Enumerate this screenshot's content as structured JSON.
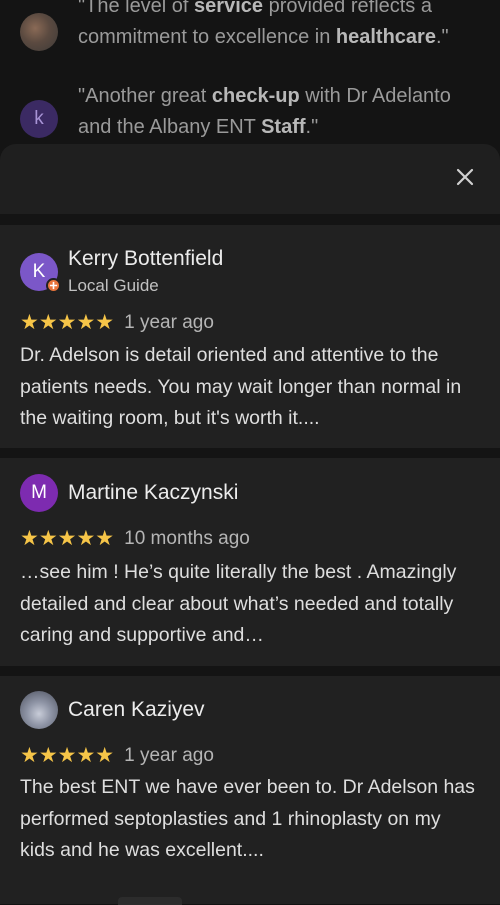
{
  "background_snippets": [
    {
      "avatar_letter": "",
      "parts": [
        {
          "text": "\"The level of ",
          "bold": false
        },
        {
          "text": "service",
          "bold": true
        },
        {
          "text": " provided reflects a commitment to excellence in ",
          "bold": false
        },
        {
          "text": "healthcare",
          "bold": true
        },
        {
          "text": ".\"",
          "bold": false
        }
      ]
    },
    {
      "avatar_letter": "k",
      "parts": [
        {
          "text": "\"Another great ",
          "bold": false
        },
        {
          "text": "check-up",
          "bold": true
        },
        {
          "text": " with Dr Adelanto and the Albany ENT ",
          "bold": false
        },
        {
          "text": "Staff",
          "bold": true
        },
        {
          "text": ".\"",
          "bold": false
        }
      ]
    }
  ],
  "sheet": {
    "close_icon": "close-icon"
  },
  "reviews": [
    {
      "avatar_letter": "K",
      "name": "Kerry Bottenfield",
      "subtitle": "Local Guide",
      "stars": "★★★★★",
      "rating": 5,
      "date": "1 year ago",
      "text": "Dr. Adelson is detail oriented and attentive to the patients needs. You may wait longer than normal in the waiting room, but it's worth it...."
    },
    {
      "avatar_letter": "M",
      "name": "Martine Kaczynski",
      "stars": "★★★★★",
      "rating": 5,
      "date": "10 months ago",
      "text": "…see him ! He’s quite literally the best . Amazingly detailed and clear about what’s needed and totally caring and supportive and…"
    },
    {
      "avatar_letter": "",
      "name": "Caren Kaziyev",
      "stars": "★★★★★",
      "rating": 5,
      "date": "1 year ago",
      "text": "The best ENT we have ever been to. Dr Adelson has performed septoplasties and 1 rhinoplasty on my kids and he was excellent...."
    }
  ],
  "colors": {
    "star": "#f6c548",
    "local_guide_badge": "#e8743b",
    "avatar_k": "#7b57c8",
    "avatar_m": "#7d2bb0"
  }
}
